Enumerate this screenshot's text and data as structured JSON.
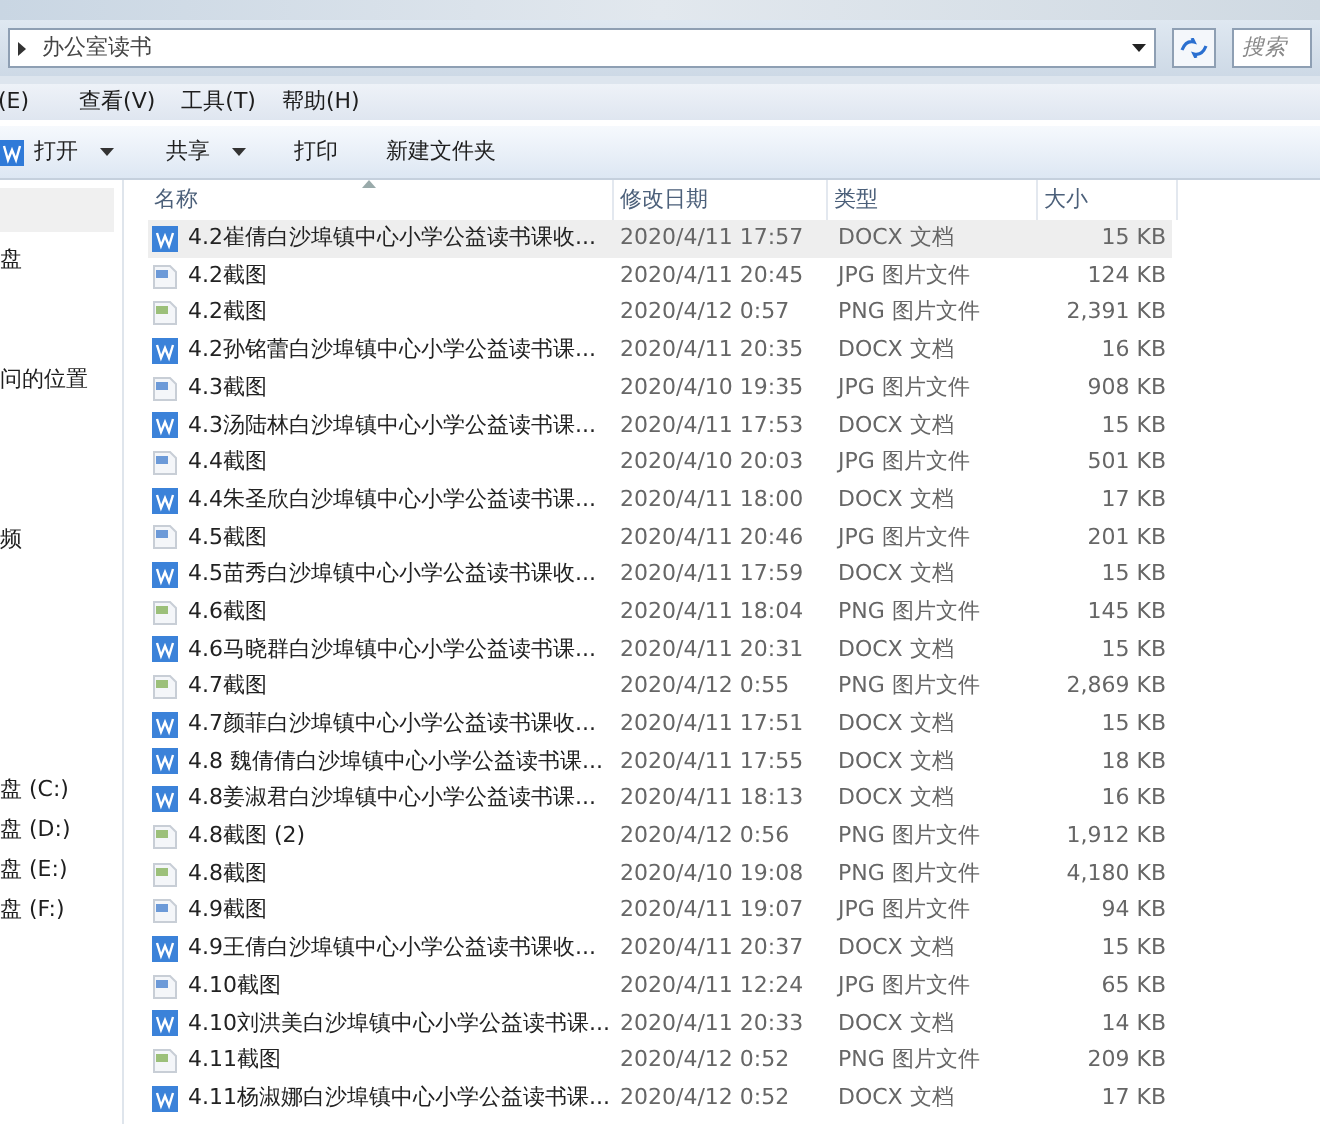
{
  "address_bar": {
    "path": "办公室读书",
    "search_placeholder": "搜索"
  },
  "menu": [
    "(E)",
    "查看(V)",
    "工具(T)",
    "帮助(H)"
  ],
  "toolbar": [
    {
      "label": "打开",
      "kind": "open"
    },
    {
      "label": "共享",
      "kind": "dropdown"
    },
    {
      "label": "打印",
      "kind": "plain"
    },
    {
      "label": "新建文件夹",
      "kind": "plain"
    }
  ],
  "nav_pane": [
    "盘",
    "问的位置",
    "频",
    "盘 (C:)",
    "盘 (D:)",
    "盘 (E:)",
    "盘 (F:)"
  ],
  "columns": [
    "名称",
    "修改日期",
    "类型",
    "大小"
  ],
  "rows": [
    {
      "name": "4.2崔倩白沙埠镇中心小学公益读书课收...",
      "date": "2020/4/11 17:57",
      "type": "DOCX 文档",
      "size": "15 KB",
      "kind": "docx",
      "selected": true
    },
    {
      "name": "4.2截图",
      "date": "2020/4/11 20:45",
      "type": "JPG 图片文件",
      "size": "124 KB",
      "kind": "jpg",
      "selected": false
    },
    {
      "name": "4.2截图",
      "date": "2020/4/12 0:57",
      "type": "PNG 图片文件",
      "size": "2,391 KB",
      "kind": "png",
      "selected": false
    },
    {
      "name": "4.2孙铭蕾白沙埠镇中心小学公益读书课...",
      "date": "2020/4/11 20:35",
      "type": "DOCX 文档",
      "size": "16 KB",
      "kind": "docx",
      "selected": false
    },
    {
      "name": "4.3截图",
      "date": "2020/4/10 19:35",
      "type": "JPG 图片文件",
      "size": "908 KB",
      "kind": "jpg",
      "selected": false
    },
    {
      "name": "4.3汤陆林白沙埠镇中心小学公益读书课...",
      "date": "2020/4/11 17:53",
      "type": "DOCX 文档",
      "size": "15 KB",
      "kind": "docx",
      "selected": false
    },
    {
      "name": "4.4截图",
      "date": "2020/4/10 20:03",
      "type": "JPG 图片文件",
      "size": "501 KB",
      "kind": "jpg",
      "selected": false
    },
    {
      "name": "4.4朱圣欣白沙埠镇中心小学公益读书课...",
      "date": "2020/4/11 18:00",
      "type": "DOCX 文档",
      "size": "17 KB",
      "kind": "docx",
      "selected": false
    },
    {
      "name": "4.5截图",
      "date": "2020/4/11 20:46",
      "type": "JPG 图片文件",
      "size": "201 KB",
      "kind": "jpg",
      "selected": false
    },
    {
      "name": "4.5苗秀白沙埠镇中心小学公益读书课收...",
      "date": "2020/4/11 17:59",
      "type": "DOCX 文档",
      "size": "15 KB",
      "kind": "docx",
      "selected": false
    },
    {
      "name": "4.6截图",
      "date": "2020/4/11 18:04",
      "type": "PNG 图片文件",
      "size": "145 KB",
      "kind": "png",
      "selected": false
    },
    {
      "name": "4.6马晓群白沙埠镇中心小学公益读书课...",
      "date": "2020/4/11 20:31",
      "type": "DOCX 文档",
      "size": "15 KB",
      "kind": "docx",
      "selected": false
    },
    {
      "name": "4.7截图",
      "date": "2020/4/12 0:55",
      "type": "PNG 图片文件",
      "size": "2,869 KB",
      "kind": "png",
      "selected": false
    },
    {
      "name": "4.7颜菲白沙埠镇中心小学公益读书课收...",
      "date": "2020/4/11 17:51",
      "type": "DOCX 文档",
      "size": "15 KB",
      "kind": "docx",
      "selected": false
    },
    {
      "name": "4.8 魏倩倩白沙埠镇中心小学公益读书课...",
      "date": "2020/4/11 17:55",
      "type": "DOCX 文档",
      "size": "18 KB",
      "kind": "docx",
      "selected": false
    },
    {
      "name": "4.8姜淑君白沙埠镇中心小学公益读书课...",
      "date": "2020/4/11 18:13",
      "type": "DOCX 文档",
      "size": "16 KB",
      "kind": "docx",
      "selected": false
    },
    {
      "name": "4.8截图 (2)",
      "date": "2020/4/12 0:56",
      "type": "PNG 图片文件",
      "size": "1,912 KB",
      "kind": "png",
      "selected": false
    },
    {
      "name": "4.8截图",
      "date": "2020/4/10 19:08",
      "type": "PNG 图片文件",
      "size": "4,180 KB",
      "kind": "png",
      "selected": false
    },
    {
      "name": "4.9截图",
      "date": "2020/4/11 19:07",
      "type": "JPG 图片文件",
      "size": "94 KB",
      "kind": "jpg",
      "selected": false
    },
    {
      "name": "4.9王倩白沙埠镇中心小学公益读书课收...",
      "date": "2020/4/11 20:37",
      "type": "DOCX 文档",
      "size": "15 KB",
      "kind": "docx",
      "selected": false
    },
    {
      "name": "4.10截图",
      "date": "2020/4/11 12:24",
      "type": "JPG 图片文件",
      "size": "65 KB",
      "kind": "jpg",
      "selected": false
    },
    {
      "name": "4.10刘洪美白沙埠镇中心小学公益读书课...",
      "date": "2020/4/11 20:33",
      "type": "DOCX 文档",
      "size": "14 KB",
      "kind": "docx",
      "selected": false
    },
    {
      "name": "4.11截图",
      "date": "2020/4/12 0:52",
      "type": "PNG 图片文件",
      "size": "209 KB",
      "kind": "png",
      "selected": false
    },
    {
      "name": "4.11杨淑娜白沙埠镇中心小学公益读书课...",
      "date": "2020/4/12 0:52",
      "type": "DOCX 文档",
      "size": "17 KB",
      "kind": "docx",
      "selected": false
    }
  ]
}
